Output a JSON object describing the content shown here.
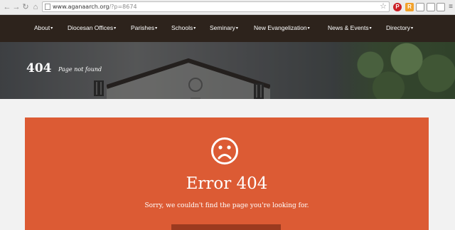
{
  "browser": {
    "url_domain": "www.aganaarch.org",
    "url_path": "/?p=8674",
    "back_icon": "arrow-left",
    "forward_icon": "arrow-right",
    "reload_icon": "reload",
    "home_icon": "home",
    "star_icon": "star",
    "extensions": [
      {
        "name": "pinterest",
        "color": "#cb2027",
        "glyph": "P"
      },
      {
        "name": "rss",
        "color": "#f2a22c",
        "glyph": "R"
      },
      {
        "name": "cast",
        "color": "#8a8a8a",
        "glyph": ""
      },
      {
        "name": "window",
        "color": "#9a9a9a",
        "glyph": ""
      },
      {
        "name": "save",
        "color": "#8a8a8a",
        "glyph": ""
      },
      {
        "name": "menu",
        "color": "#7a7a7a",
        "glyph": "≡"
      }
    ]
  },
  "nav": {
    "items": [
      {
        "label": "About"
      },
      {
        "label": "Diocesan Offices"
      },
      {
        "label": "Parishes"
      },
      {
        "label": "Schools"
      },
      {
        "label": "Seminary"
      },
      {
        "label": "New Evangelization"
      },
      {
        "label": "News & Events"
      },
      {
        "label": "Directory"
      }
    ],
    "caret": "▾"
  },
  "banner": {
    "code": "404",
    "subtitle": "Page not found"
  },
  "error": {
    "icon": "sad-face",
    "title": "Error 404",
    "message": "Sorry, we couldn't find the page you're looking for.",
    "accent_color": "#dc5b34"
  }
}
